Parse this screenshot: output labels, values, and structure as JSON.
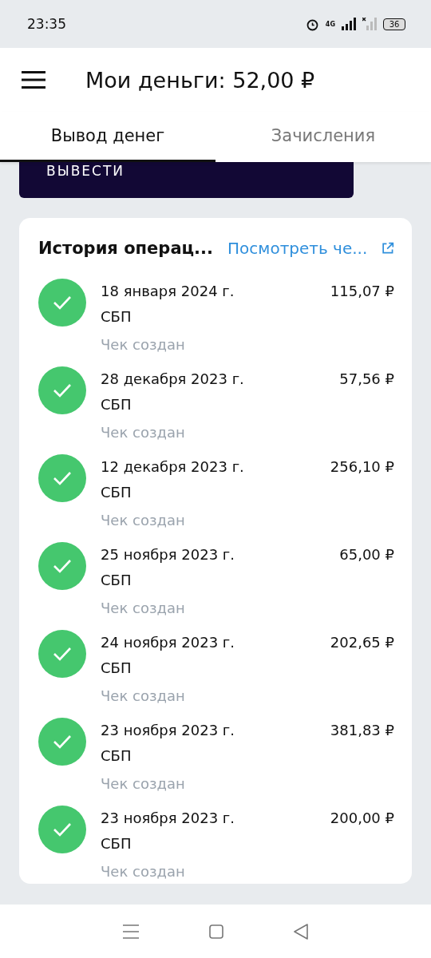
{
  "status_bar": {
    "time": "23:35",
    "network": "4G",
    "battery": "36"
  },
  "header": {
    "title": "Мои деньги: 52,00 ₽"
  },
  "tabs": [
    {
      "label": "Вывод денег",
      "selected": true
    },
    {
      "label": "Зачисления",
      "selected": false
    }
  ],
  "withdraw_button": {
    "label": "ВЫВЕСТИ"
  },
  "history": {
    "title": "История операц...",
    "link": "Посмотреть че...",
    "operations": [
      {
        "date": "18 января 2024 г.",
        "method": "СБП",
        "status": "Чек создан",
        "amount": "115,07 ₽",
        "done": true
      },
      {
        "date": "28 декабря 2023 г.",
        "method": "СБП",
        "status": "Чек создан",
        "amount": "57,56 ₽",
        "done": true
      },
      {
        "date": "12 декабря 2023 г.",
        "method": "СБП",
        "status": "Чек создан",
        "amount": "256,10 ₽",
        "done": true
      },
      {
        "date": "25 ноября 2023 г.",
        "method": "СБП",
        "status": "Чек создан",
        "amount": "65,00 ₽",
        "done": true
      },
      {
        "date": "24 ноября 2023 г.",
        "method": "СБП",
        "status": "Чек создан",
        "amount": "202,65 ₽",
        "done": true
      },
      {
        "date": "23 ноября 2023 г.",
        "method": "СБП",
        "status": "Чек создан",
        "amount": "381,83 ₽",
        "done": true
      },
      {
        "date": "23 ноября 2023 г.",
        "method": "СБП",
        "status": "Чек создан",
        "amount": "200,00 ₽",
        "done": true
      }
    ]
  }
}
